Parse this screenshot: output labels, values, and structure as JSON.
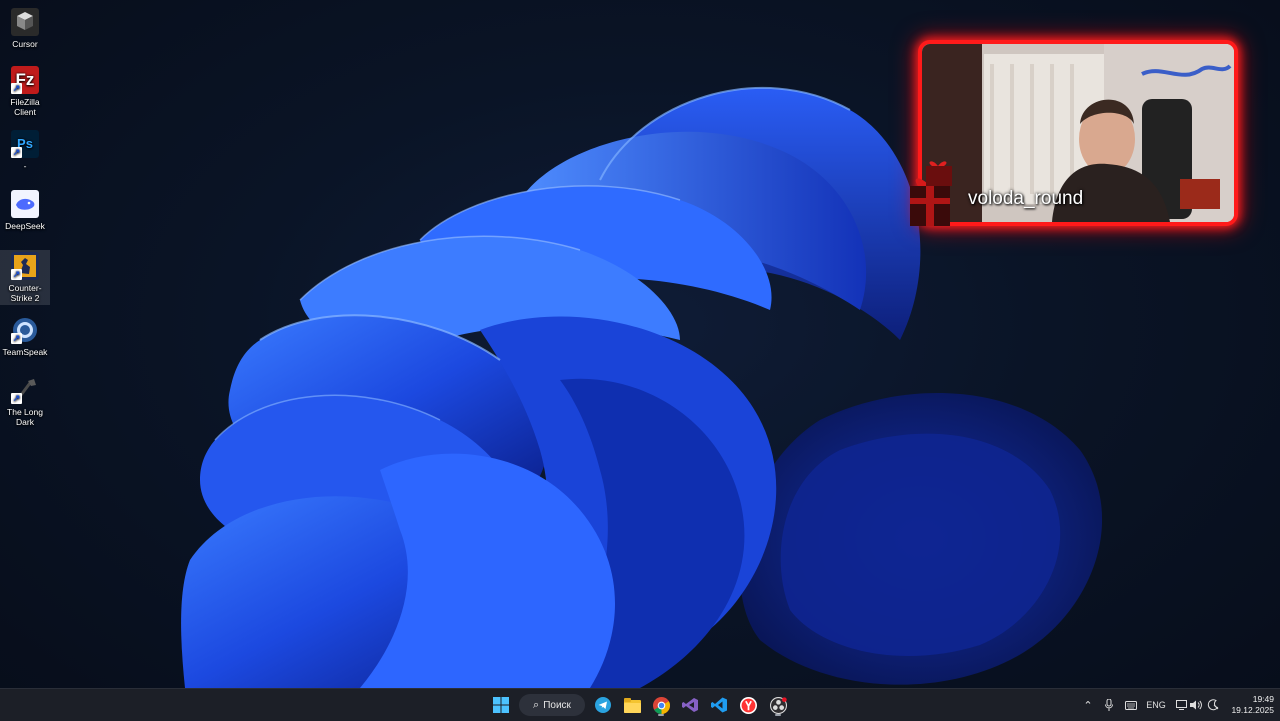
{
  "desktop_icons": [
    {
      "label": "Cursor",
      "icon": "cursor-app-icon"
    },
    {
      "label": "FileZilla Client",
      "icon": "filezilla-icon"
    },
    {
      "label": "-",
      "icon": "photoshop-icon"
    },
    {
      "label": "DeepSeek",
      "icon": "deepseek-icon"
    },
    {
      "label": "Counter-Strike 2",
      "icon": "counter-strike-icon"
    },
    {
      "label": "TeamSpeak",
      "icon": "teamspeak-icon"
    },
    {
      "label": "The Long Dark",
      "icon": "the-long-dark-icon"
    }
  ],
  "webcam": {
    "username": "voloda_round",
    "border_color": "#ff1a1a"
  },
  "taskbar": {
    "search_label": "Поиск",
    "apps": [
      "start-icon",
      "telegram-icon",
      "file-explorer-icon",
      "chrome-icon",
      "visual-studio-icon",
      "vscode-icon",
      "yandex-browser-icon",
      "obs-icon"
    ],
    "tray": {
      "language": "ENG"
    },
    "clock": {
      "time": "19:49",
      "date": "19.12.2025"
    }
  },
  "colors": {
    "wallpaper_blue": "#1f4fe6",
    "taskbar_bg": "#1c1f27"
  }
}
